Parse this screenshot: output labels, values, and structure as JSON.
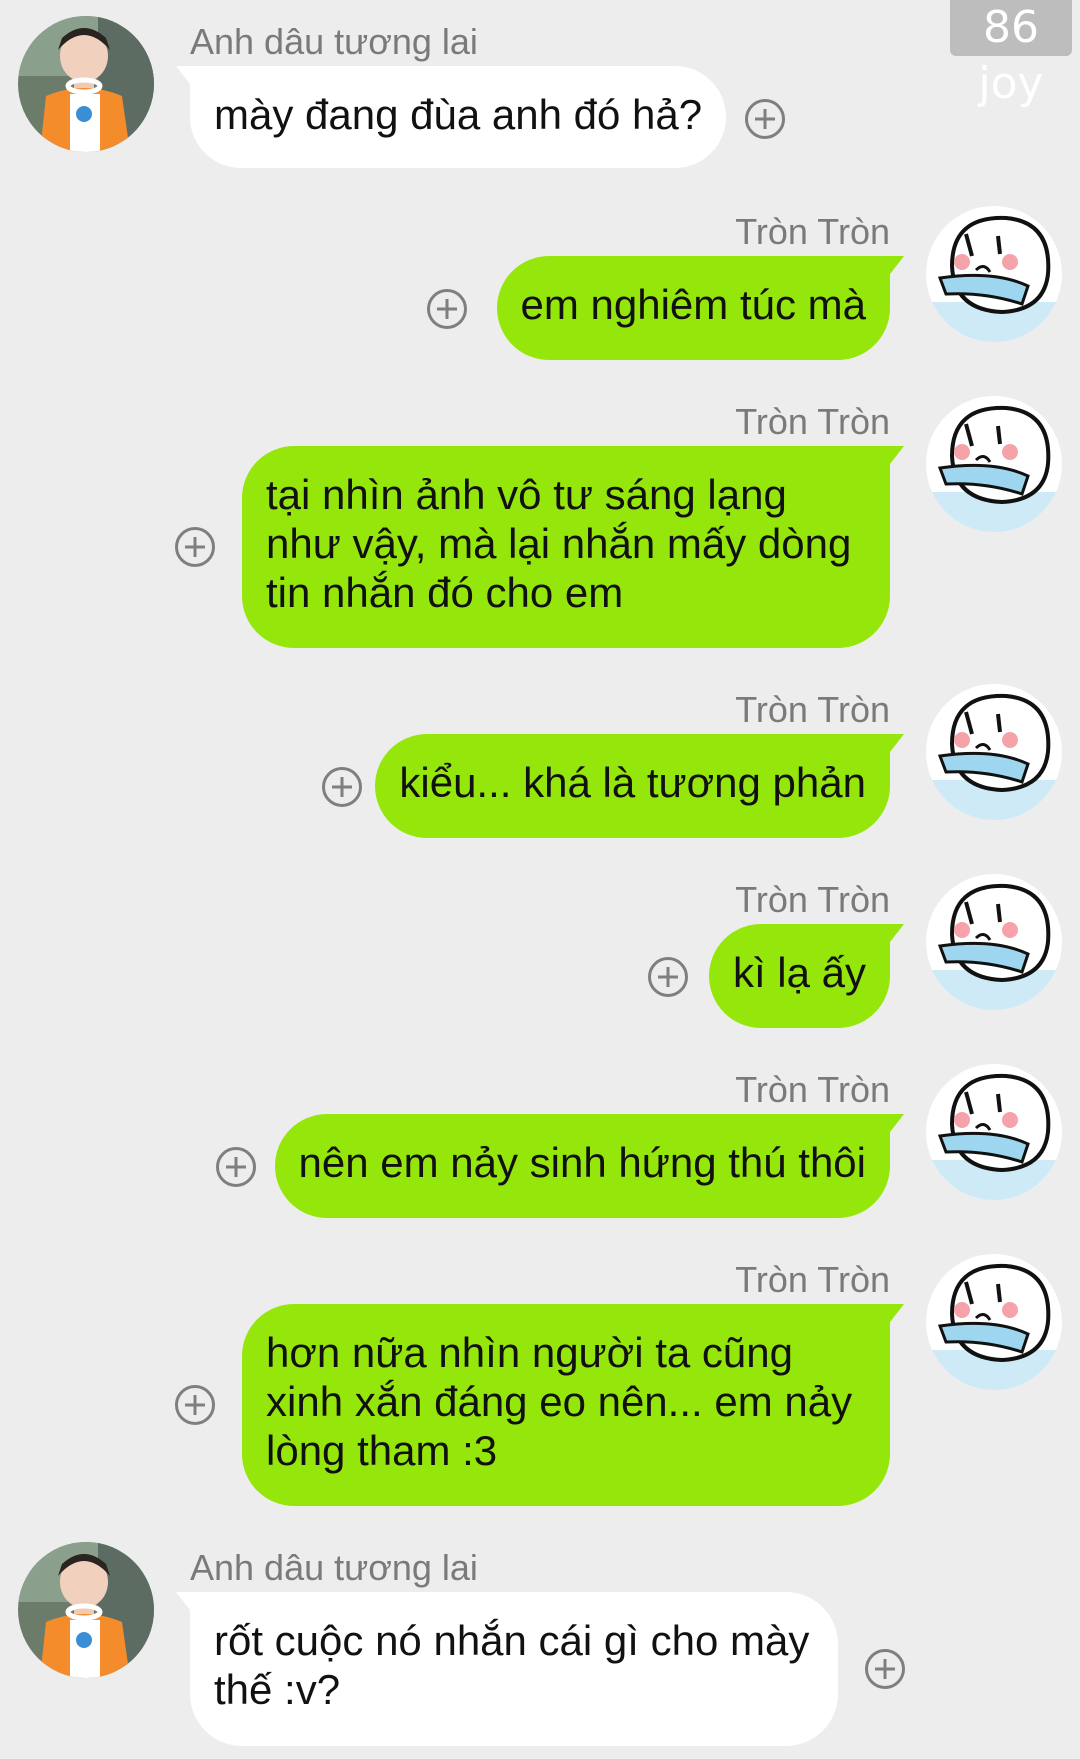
{
  "watermark": "86 joy",
  "messages": [
    {
      "side": "left",
      "sender": "Anh dâu tương lai",
      "text": "mày đang đùa anh đó hả?"
    },
    {
      "side": "right",
      "sender": "Tròn Tròn",
      "text": "em nghiêm túc mà"
    },
    {
      "side": "right",
      "sender": "Tròn Tròn",
      "text": "tại nhìn ảnh vô tư sáng lạng như vậy, mà lại nhắn mấy dòng tin nhắn đó cho em"
    },
    {
      "side": "right",
      "sender": "Tròn Tròn",
      "text": "kiểu... khá là tương phản"
    },
    {
      "side": "right",
      "sender": "Tròn Tròn",
      "text": "kì lạ ấy"
    },
    {
      "side": "right",
      "sender": "Tròn Tròn",
      "text": "nên em nảy sinh hứng thú thôi"
    },
    {
      "side": "right",
      "sender": "Tròn Tròn",
      "text": "hơn nữa nhìn người ta cũng xinh xắn đáng eo nên... em nảy lòng tham :3"
    },
    {
      "side": "left",
      "sender": "Anh dâu tương lai",
      "text": "rốt cuộc nó nhắn cái gì cho mày thế :v?"
    }
  ],
  "colors": {
    "background": "#ededed",
    "incoming_bubble": "#ffffff",
    "outgoing_bubble": "#95e60a"
  },
  "icons": {
    "plus": "plus-circle-icon",
    "left_avatar": "avatar-photo",
    "right_avatar": "crying-sticker-avatar"
  }
}
